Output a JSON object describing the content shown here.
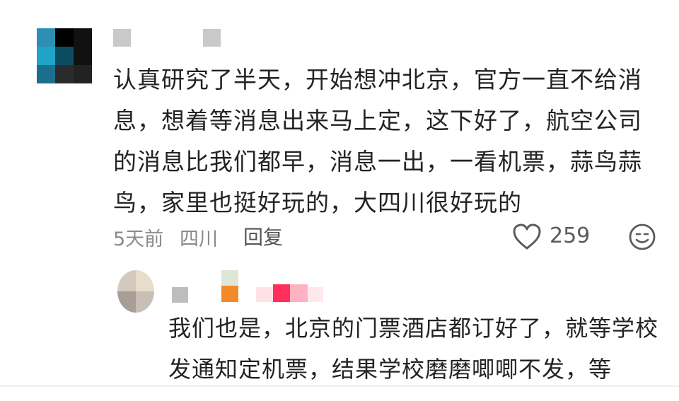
{
  "comment": {
    "text": "认真研究了半天，开始想冲北京，官方一直不给消息，想着等消息出来马上定，这下好了，航空公司的消息比我们都早，消息一出，一看机票，蒜鸟蒜鸟，家里也挺好玩的，大四川很好玩的",
    "time": "5天前",
    "location": "四川",
    "reply_label": "回复",
    "like_count": "259",
    "icons": {
      "like": "heart-icon",
      "emoji": "emoji-icon"
    },
    "avatar_colors": [
      "#2d8fb5",
      "#000000",
      "#111111",
      "#1fa3c6",
      "#0c4c63",
      "#111111",
      "#1a6f8e",
      "#2b2b2b",
      "#222222"
    ]
  },
  "reply": {
    "text": "我们也是，北京的门票酒店都订好了，就等学校发通知定机票，结果学校磨磨唧唧不发，等",
    "avatar_colors": [
      "#d3c9bf",
      "#e8dccb",
      "#a89e95",
      "#c8bfb6"
    ],
    "username_block_colors": [
      "#bdbdbd",
      "#f28a2c",
      "#e3e3e3",
      "#ff2e5a",
      "#ffb3c2"
    ]
  }
}
